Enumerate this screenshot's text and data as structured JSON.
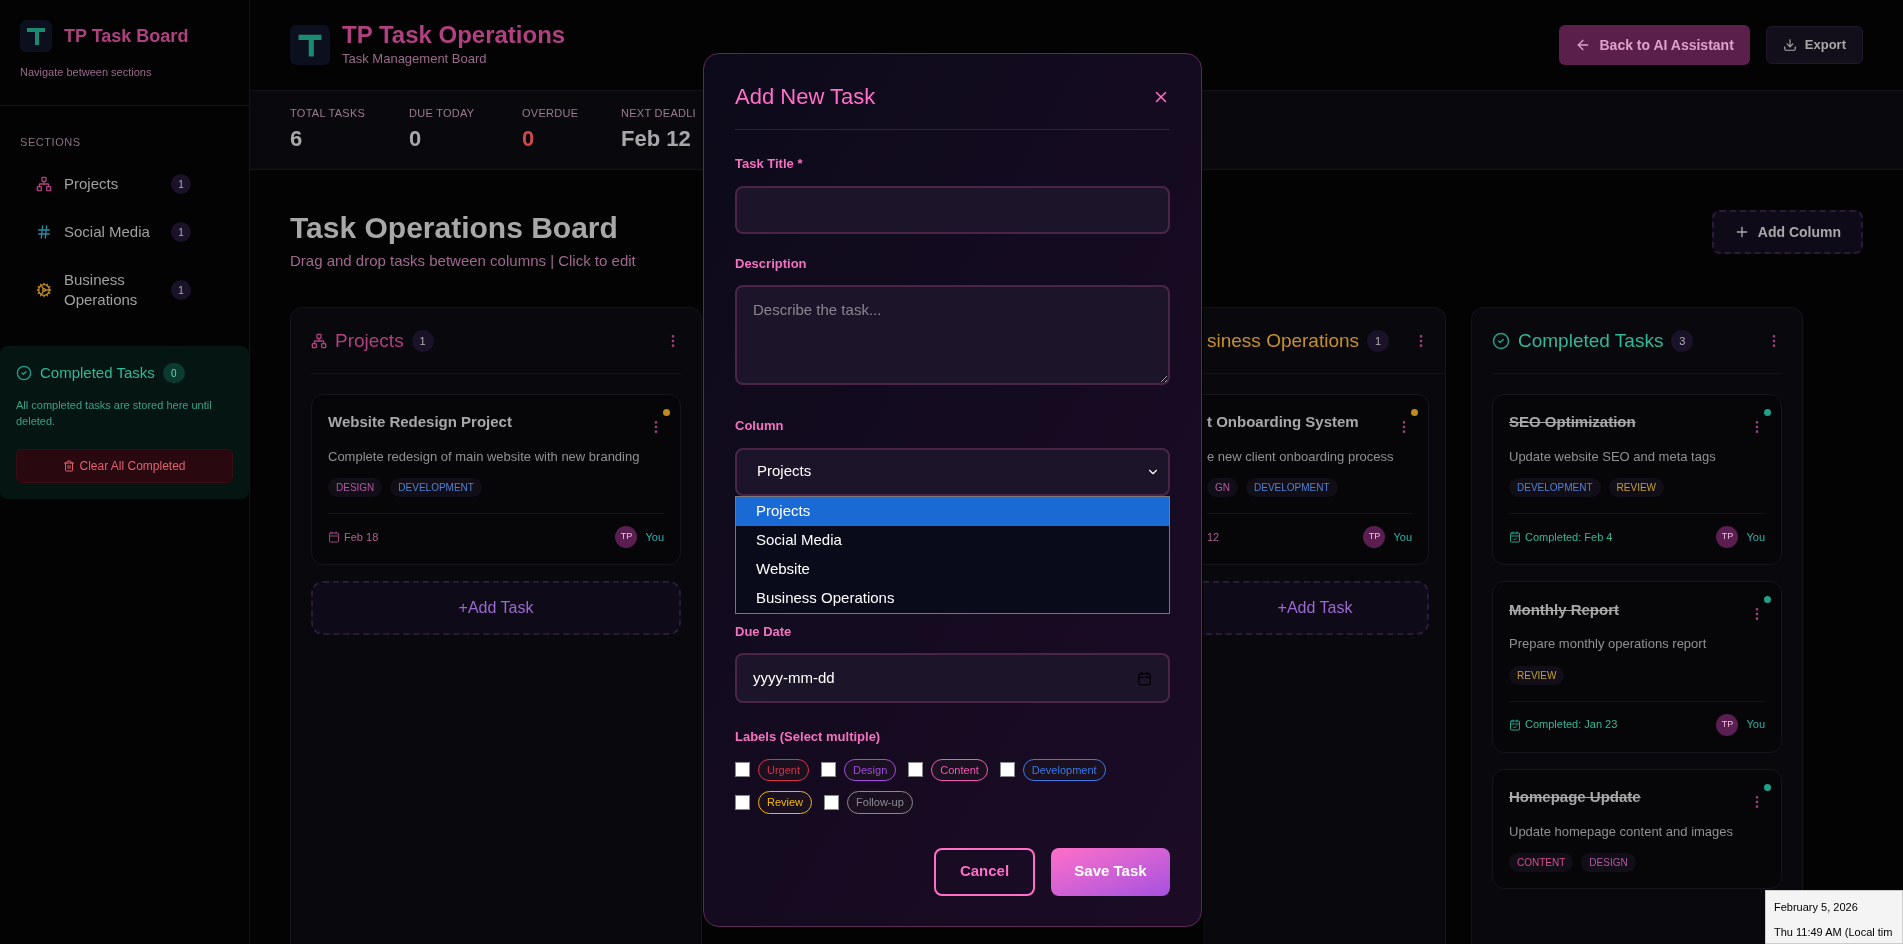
{
  "sidebar": {
    "title": "TP Task Board",
    "subtitle": "Navigate between sections",
    "section_heading": "SECTIONS",
    "items": [
      {
        "label": "Projects",
        "count": "1"
      },
      {
        "label": "Social Media",
        "count": "1"
      },
      {
        "label": "Business Operations",
        "count": "1"
      }
    ],
    "completed": {
      "title": "Completed Tasks",
      "count": "0",
      "text": "All completed tasks are stored here until deleted.",
      "button": "Clear All Completed"
    }
  },
  "header": {
    "title": "TP Task Operations",
    "subtitle": "Task Management Board",
    "back_button": "Back to AI Assistant",
    "export_button": "Export"
  },
  "stats": [
    {
      "label": "TOTAL TASKS",
      "value": "6",
      "kind": "normal"
    },
    {
      "label": "DUE TODAY",
      "value": "0",
      "kind": "normal"
    },
    {
      "label": "OVERDUE",
      "value": "0",
      "kind": "danger"
    },
    {
      "label": "NEXT DEADLI",
      "value": "Feb 12",
      "kind": "normal"
    }
  ],
  "board": {
    "title": "Task Operations Board",
    "subtitle": "Drag and drop tasks between columns | Click to edit",
    "add_column": "Add Column",
    "columns": [
      {
        "kind": "section",
        "title": "Projects",
        "count": "1",
        "add_task": "+Add Task",
        "cards": [
          {
            "title": "Website Redesign Project",
            "description": "Complete redesign of main website with new branding",
            "completed": false,
            "color": "#c08a20",
            "tags": [
              {
                "label": "DESIGN",
                "color": "#b05aa0"
              },
              {
                "label": "DEVELOPMENT",
                "color": "#5080d0"
              }
            ],
            "date": "Feb 18",
            "avatar": "TP",
            "assignee": "You"
          }
        ]
      },
      {
        "kind": "partial",
        "title": "siness Operations",
        "count": "1",
        "add_task": "+Add Task",
        "cards": [
          {
            "title": "t Onboarding System",
            "description": "e new client onboarding process",
            "completed": false,
            "color": "#c08a20",
            "tags": [
              {
                "label": "GN",
                "color": "#b05aa0"
              },
              {
                "label": "DEVELOPMENT",
                "color": "#5080d0"
              }
            ],
            "date": "12",
            "avatar": "TP",
            "assignee": "You"
          }
        ]
      },
      {
        "kind": "completed",
        "title": "Completed Tasks",
        "count": "3",
        "cards": [
          {
            "title": "SEO Optimization",
            "description": "Update website SEO and meta tags",
            "completed": true,
            "color": "#20a088",
            "tags": [
              {
                "label": "DEVELOPMENT",
                "color": "#5080d0"
              },
              {
                "label": "REVIEW",
                "color": "#c0a030"
              }
            ],
            "date": "Completed: Feb 4",
            "avatar": "TP",
            "assignee": "You"
          },
          {
            "title": "Monthly Report",
            "description": "Prepare monthly operations report",
            "completed": true,
            "color": "#20a088",
            "tags": [
              {
                "label": "REVIEW",
                "color": "#c0a030"
              }
            ],
            "date": "Completed: Jan 23",
            "avatar": "TP",
            "assignee": "You"
          },
          {
            "title": "Homepage Update",
            "description": "Update homepage content and images",
            "completed": true,
            "color": "#20a088",
            "tags": [
              {
                "label": "CONTENT",
                "color": "#d05090"
              },
              {
                "label": "DESIGN",
                "color": "#b05aa0"
              }
            ]
          }
        ]
      }
    ]
  },
  "modal": {
    "title": "Add New Task",
    "title_label": "Task Title *",
    "description_label": "Description",
    "description_placeholder": "Describe the task...",
    "column_label": "Column",
    "column_value": "Projects",
    "column_options": [
      {
        "label": "Projects",
        "selected": true
      },
      {
        "label": "Social Media",
        "selected": false
      },
      {
        "label": "Website",
        "selected": false
      },
      {
        "label": "Business Operations",
        "selected": false
      }
    ],
    "due_label": "Due Date",
    "due_placeholder": "yyyy-mm-dd",
    "labels_label": "Labels (Select multiple)",
    "labels": [
      {
        "label": "Urgent",
        "color": "#dc2f45",
        "checked": false
      },
      {
        "label": "Design",
        "color": "#a149e0",
        "checked": false
      },
      {
        "label": "Content",
        "color": "#ee5ab4",
        "checked": false
      },
      {
        "label": "Development",
        "color": "#3a7ae8",
        "checked": false
      },
      {
        "label": "Review",
        "color": "#f2b705",
        "checked": false
      },
      {
        "label": "Follow-up",
        "color": "#8a8a96",
        "checked": false
      }
    ],
    "cancel": "Cancel",
    "save": "Save Task"
  },
  "tooltip": {
    "date": "February 5, 2026",
    "time": "Thu 11:49 AM (Local tim"
  }
}
